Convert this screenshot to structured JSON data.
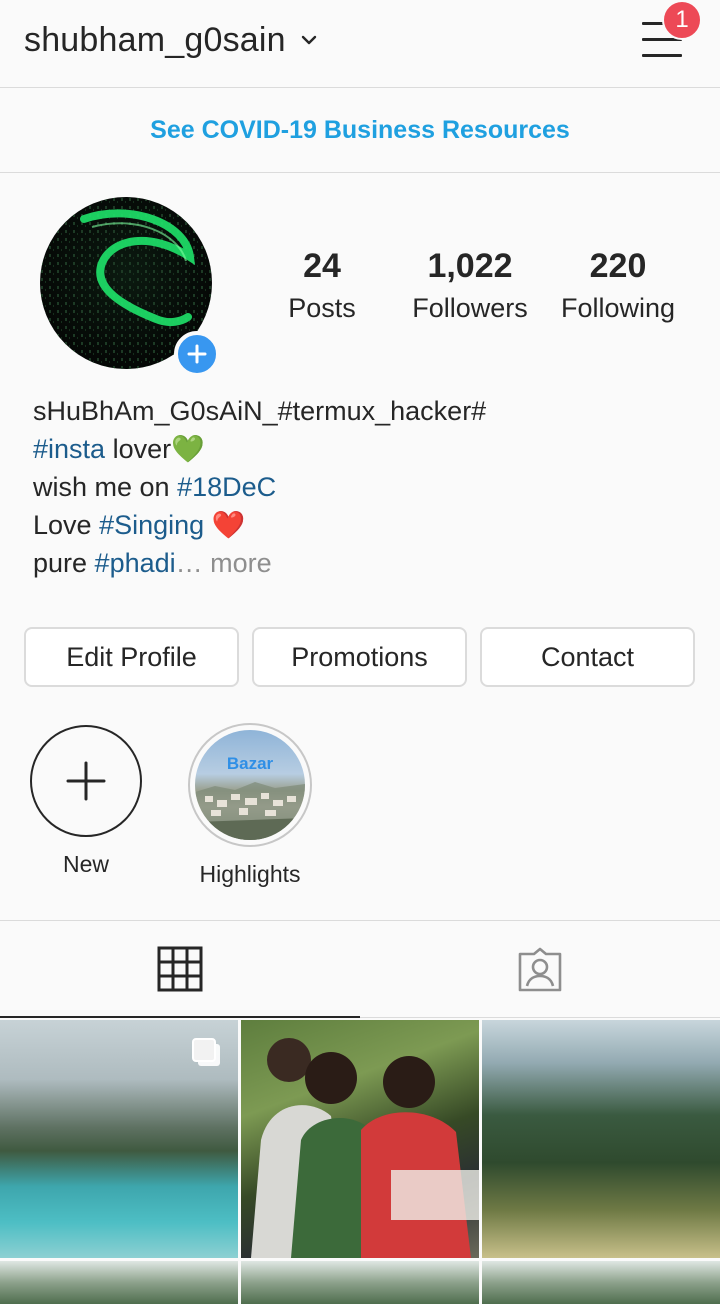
{
  "header": {
    "username": "shubham_g0sain",
    "notification_count": "1",
    "icons": {
      "dropdown": "chevron-down-icon",
      "menu": "hamburger-menu-icon"
    }
  },
  "banner": {
    "text": "See COVID-19 Business Resources",
    "color": "#1fa0e0"
  },
  "profile": {
    "stats": [
      {
        "value": "24",
        "label": "Posts"
      },
      {
        "value": "1,022",
        "label": "Followers"
      },
      {
        "value": "220",
        "label": "Following"
      }
    ],
    "bio": {
      "name": "sHuBhAm_G0sAiN_#termux_hacker#",
      "line2_tag": "#insta",
      "line2_text": " lover",
      "line2_emoji": "💚",
      "line3_text": "wish me on ",
      "line3_tag": "#18DeC",
      "line4_text": "Love ",
      "line4_tag": "#Singing",
      "line4_emoji": "❤️",
      "line5_text": "pure ",
      "line5_tag": "#phadi",
      "line5_more": "… more"
    }
  },
  "actions": {
    "edit_profile": "Edit Profile",
    "promotions": "Promotions",
    "contact": "Contact"
  },
  "highlights": {
    "new_label": "New",
    "items": [
      {
        "label": "Highlights",
        "cover_text": "Bazar"
      }
    ]
  },
  "tabs": [
    {
      "icon": "grid-icon",
      "active": true
    },
    {
      "icon": "tagged-photos-icon",
      "active": false
    }
  ],
  "colors": {
    "accent": "#3897f0",
    "hashtag": "#1c5c8c",
    "badge": "#ed4956",
    "border": "#dbdbdb"
  }
}
